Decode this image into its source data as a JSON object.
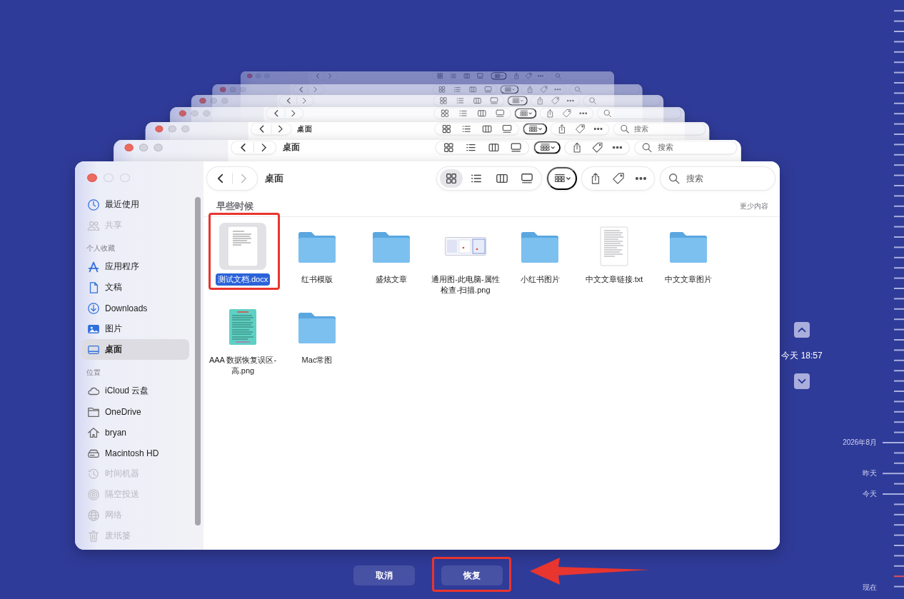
{
  "backdrop_windows": [
    {
      "title": "桌面",
      "search": {
        "placeholder": "搜索"
      }
    },
    {
      "title": "桌面",
      "search": {
        "placeholder": "搜索"
      }
    }
  ],
  "window": {
    "title": "桌面",
    "forward": {
      "disabled": true
    },
    "views": [
      {
        "kind": "icons",
        "selected": true
      },
      {
        "kind": "list",
        "selected": false
      },
      {
        "kind": "columns",
        "selected": false
      },
      {
        "kind": "gallery",
        "selected": false
      }
    ],
    "search": {
      "placeholder": "搜索"
    },
    "sidebar": {
      "sections": [
        {
          "items": [
            {
              "label": "最近使用",
              "kind": "recents",
              "selected": false,
              "disabled": false
            },
            {
              "label": "共享",
              "kind": "shared",
              "selected": false,
              "disabled": true
            }
          ]
        },
        {
          "header": "个人收藏",
          "items": [
            {
              "label": "应用程序",
              "kind": "applications",
              "selected": false,
              "disabled": false
            },
            {
              "label": "文稿",
              "kind": "documents",
              "selected": false,
              "disabled": false
            },
            {
              "label": "Downloads",
              "kind": "downloads",
              "selected": false,
              "disabled": false
            },
            {
              "label": "图片",
              "kind": "pictures",
              "selected": false,
              "disabled": false
            },
            {
              "label": "桌面",
              "kind": "desktop",
              "selected": true,
              "disabled": false
            }
          ]
        },
        {
          "header": "位置",
          "items": [
            {
              "label": "iCloud 云盘",
              "kind": "icloud",
              "selected": false,
              "disabled": false
            },
            {
              "label": "OneDrive",
              "kind": "folder",
              "selected": false,
              "disabled": false
            },
            {
              "label": "bryan",
              "kind": "home",
              "selected": false,
              "disabled": false
            },
            {
              "label": "Macintosh HD",
              "kind": "disk",
              "selected": false,
              "disabled": false
            },
            {
              "label": "时间机器",
              "kind": "time-machine",
              "selected": false,
              "disabled": true
            },
            {
              "label": "隔空投送",
              "kind": "airdrop",
              "selected": false,
              "disabled": true
            },
            {
              "label": "网络",
              "kind": "network",
              "selected": false,
              "disabled": true
            },
            {
              "label": "废纸篓",
              "kind": "trash",
              "selected": false,
              "disabled": true
            }
          ]
        }
      ]
    },
    "section": {
      "title": "早些时候",
      "toggle": "更少内容"
    },
    "files": [
      {
        "name": "测试文档.docx",
        "kind": "document",
        "selected": true
      },
      {
        "name": "红书模版",
        "kind": "folder",
        "selected": false
      },
      {
        "name": "盛炫文章",
        "kind": "folder",
        "selected": false
      },
      {
        "name": "通用图-此电脑-属性检查-扫描.png",
        "kind": "screenshot",
        "selected": false
      },
      {
        "name": "小红书图片",
        "kind": "folder",
        "selected": false
      },
      {
        "name": "中文文章链接.txt",
        "kind": "text",
        "selected": false
      },
      {
        "name": "中文文章图片",
        "kind": "folder",
        "selected": false
      },
      {
        "name": "AAA 数据恢复误区-高.png",
        "kind": "image",
        "selected": false
      },
      {
        "name": "Mac常图",
        "kind": "folder",
        "selected": false
      }
    ]
  },
  "timeline": {
    "current": "今天 18:57",
    "marks": [
      {
        "label": "2026年8月"
      },
      {
        "label": "昨天"
      },
      {
        "label": "今天"
      },
      {
        "label": "现在"
      }
    ]
  },
  "buttons": [
    {
      "label": "取消"
    },
    {
      "label": "恢复"
    }
  ]
}
